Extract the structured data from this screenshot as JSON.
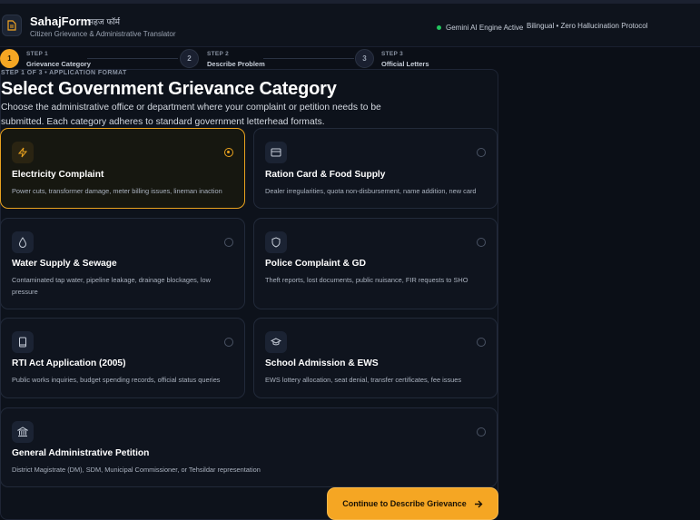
{
  "header": {
    "brand": "SahajForm",
    "brand_hindi": "सहज फॉर्म",
    "subtitle": "Citizen Grievance & Administrative Translator",
    "engine_status": "Gemini AI Engine Active",
    "protocol": "Bilingual • Zero Hallucination Protocol"
  },
  "steps": [
    {
      "number": "1",
      "kicker": "STEP 1",
      "title": "Grievance Category",
      "state": "active"
    },
    {
      "number": "2",
      "kicker": "STEP 2",
      "title": "Describe Problem",
      "state": "idle"
    },
    {
      "number": "3",
      "kicker": "STEP 3",
      "title": "Official Letters",
      "state": "idle"
    }
  ],
  "main": {
    "kicker": "STEP 1 OF 3 • APPLICATION FORMAT",
    "title": "Select Government Grievance Category",
    "description": "Choose the administrative office or department where your complaint or petition needs to be submitted. Each category adheres to standard government letterhead formats."
  },
  "categories": [
    {
      "title": "Electricity Complaint",
      "desc": "Power cuts, transformer damage, meter billing issues, lineman inaction",
      "icon": "lightning-icon",
      "selected": true
    },
    {
      "title": "Ration Card & Food Supply",
      "desc": "Dealer irregularities, quota non-disbursement, name addition, new card",
      "icon": "card-icon",
      "selected": false
    },
    {
      "title": "Water Supply & Sewage",
      "desc": "Contaminated tap water, pipeline leakage, drainage blockages, low pressure",
      "icon": "water-drop-icon",
      "selected": false
    },
    {
      "title": "Police Complaint & GD",
      "desc": "Theft reports, lost documents, public nuisance, FIR requests to SHO",
      "icon": "shield-icon",
      "selected": false
    },
    {
      "title": "RTI Act Application (2005)",
      "desc": "Public works inquiries, budget spending records, official status queries",
      "icon": "book-icon",
      "selected": false
    },
    {
      "title": "School Admission & EWS",
      "desc": "EWS lottery allocation, seat denial, transfer certificates, fee issues",
      "icon": "graduation-cap-icon",
      "selected": false
    },
    {
      "title": "General Administrative Petition",
      "desc": "District Magistrate (DM), SDM, Municipal Commissioner, or Tehsildar representation",
      "icon": "building-icon",
      "selected": false
    }
  ],
  "cta": {
    "label": "Continue to Describe Grievance"
  },
  "colors": {
    "accent": "#f5a623",
    "background": "#0b0f17",
    "status_green": "#22c55e"
  }
}
